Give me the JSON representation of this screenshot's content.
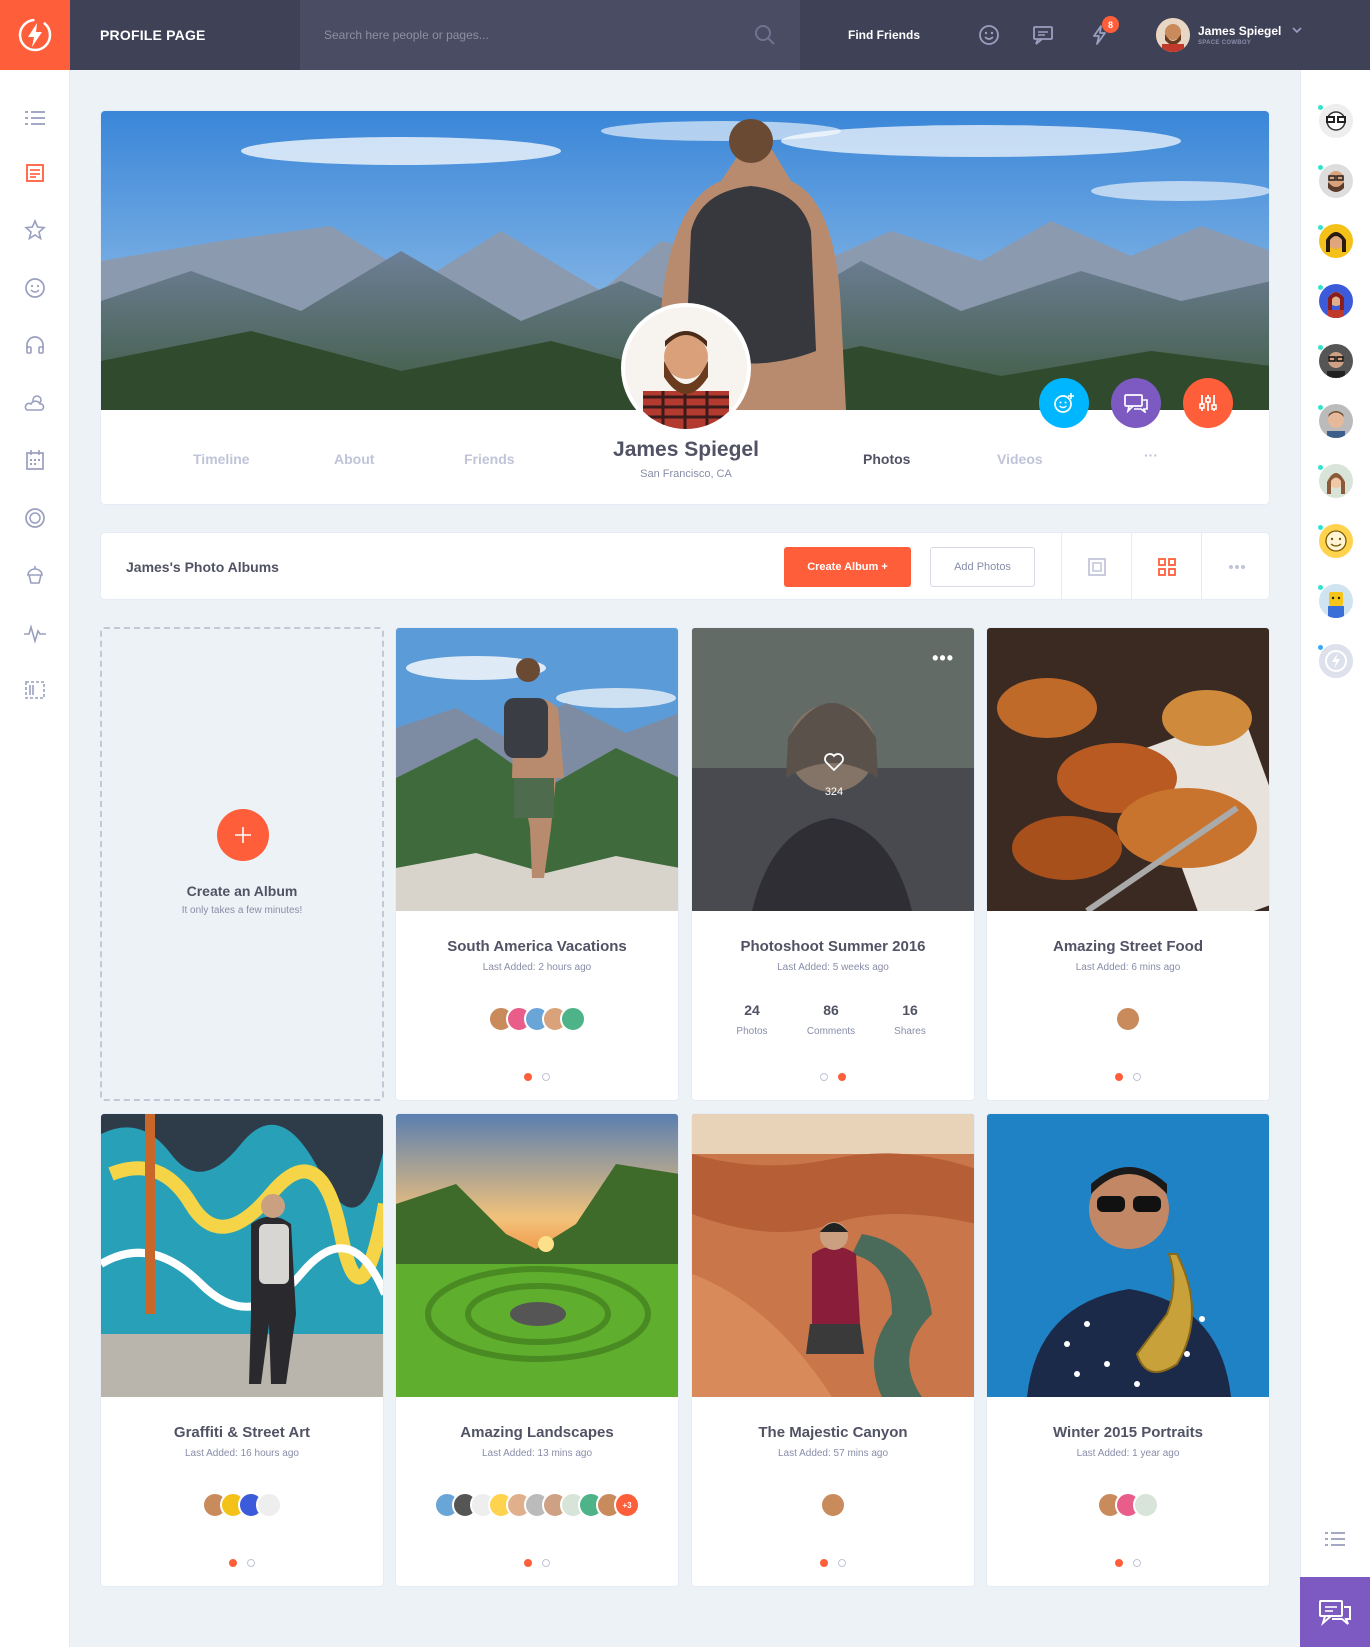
{
  "header": {
    "page_title": "PROFILE PAGE",
    "search_placeholder": "Search here people or pages...",
    "find_friends": "Find Friends",
    "notification_count": "8",
    "user_name": "James Spiegel",
    "user_subtitle": "SPACE COWBOY"
  },
  "left_nav": [
    "menu-icon",
    "newsfeed-icon",
    "star-icon",
    "happy-face-icon",
    "headphones-icon",
    "weather-icon",
    "calendar-icon",
    "badge-icon",
    "cupcake-icon",
    "stats-icon",
    "manage-widgets-icon"
  ],
  "profile": {
    "name": "James Spiegel",
    "location": "San Francisco, CA",
    "tabs": [
      {
        "label": "Timeline"
      },
      {
        "label": "About"
      },
      {
        "label": "Friends"
      },
      {
        "label": "Photos"
      },
      {
        "label": "Videos"
      },
      {
        "label": "···"
      }
    ],
    "active_tab": "Photos"
  },
  "albums_bar": {
    "title": "James's Photo Albums",
    "create_album": "Create Album  +",
    "add_photos": "Add Photos"
  },
  "create_card": {
    "title": "Create an Album",
    "subtitle": "It only takes a few minutes!"
  },
  "albums": [
    {
      "title": "South America Vacations",
      "last_added": "Last Added: 2 hours ago"
    },
    {
      "title": "Photoshoot Summer 2016",
      "last_added": "Last Added: 5 weeks ago",
      "likes": "324",
      "stats": [
        {
          "value": "24",
          "label": "Photos"
        },
        {
          "value": "86",
          "label": "Comments"
        },
        {
          "value": "16",
          "label": "Shares"
        }
      ]
    },
    {
      "title": "Amazing Street Food",
      "last_added": "Last Added: 6 mins ago"
    },
    {
      "title": "Graffiti & Street Art",
      "last_added": "Last Added: 16 hours ago"
    },
    {
      "title": "Amazing Landscapes",
      "last_added": "Last Added: 13 mins ago",
      "more_count": "+3"
    },
    {
      "title": "The Majestic Canyon",
      "last_added": "Last Added: 57 mins ago"
    },
    {
      "title": "Winter 2015 Portraits",
      "last_added": "Last Added: 1 year ago"
    }
  ],
  "colors": {
    "accent": "#ff5e3a",
    "blue": "#38a9ff",
    "purple": "#7c5ac2",
    "topbar": "#3f4257"
  }
}
